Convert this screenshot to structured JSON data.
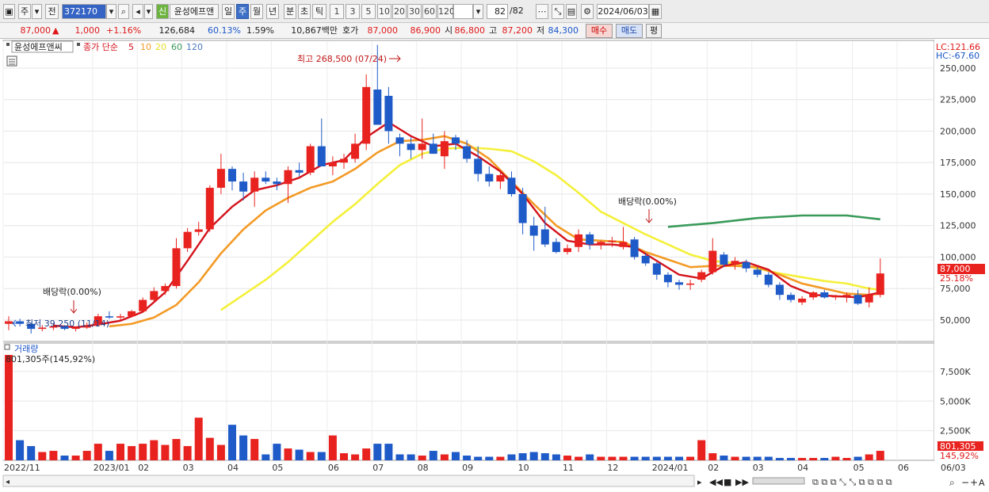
{
  "toolbar": {
    "period_type": "주",
    "prev_label": "전",
    "code": "372170",
    "name_badge": "신",
    "name": "윤성에프앤",
    "periods": [
      "일",
      "주",
      "월",
      "년",
      "분",
      "초",
      "틱"
    ],
    "active_period": "주",
    "intervals": [
      "1",
      "3",
      "5",
      "10",
      "20",
      "30",
      "60",
      "120"
    ],
    "count": "82",
    "count_total": "/82",
    "date": "2024/06/03"
  },
  "quote": {
    "price": "87,000",
    "change": "1,000",
    "change_pct": "+1.16%",
    "volume": "126,684",
    "vol_ratio": "60.13%",
    "turnover": "1.59%",
    "amount": "10,867백만",
    "ask_label": "호가",
    "ask1": "87,000",
    "ask2": "86,900",
    "open_label": "시",
    "open": "86,800",
    "high_label": "고",
    "high": "87,200",
    "low_label": "저",
    "low": "84,300",
    "buy_label": "매수",
    "sell_label": "매도",
    "avg_label": "평"
  },
  "legend": {
    "name": "윤성에프앤씨",
    "indicator": "종가 단순",
    "ma_labels": [
      "5",
      "10",
      "20",
      "60",
      "120"
    ]
  },
  "annotations": {
    "high": "최고 268,500 (07/24)",
    "low": "최저 39,250 (11/14)",
    "div1": "배당락(0.00%)",
    "div2": "배당락(0.00%)",
    "lc": "LC:121.66",
    "hc": "HC:-67.60",
    "last_price_tag": "87,000",
    "last_pct_tag": "25.18%"
  },
  "volume_panel": {
    "title": "거래량",
    "top_label": "801,305주(145,92%)",
    "last_tag": "801,305",
    "last_pct": "145,92%"
  },
  "price_axis_labels": [
    "250,000",
    "225,000",
    "200,000",
    "175,000",
    "150,000",
    "125,000",
    "100,000",
    "75,000",
    "50,000"
  ],
  "volume_axis_labels": [
    "7,500K",
    "5,000K",
    "2,500K"
  ],
  "x_axis_labels": [
    "2022/11",
    "2023/01",
    "02",
    "03",
    "04",
    "05",
    "06",
    "07",
    "08",
    "09",
    "10",
    "11",
    "12",
    "2024/01",
    "02",
    "03",
    "04",
    "05",
    "06",
    "06/03"
  ],
  "colors": {
    "up": "#e8231f",
    "down": "#1f5bc8",
    "ma5": "#d4121b",
    "ma10": "#f39a25",
    "ma20": "#f4f03a",
    "ma60": "#3a9a5a"
  },
  "chart_data": {
    "type": "candlestick",
    "x_unit": "week",
    "ohlc": [
      [
        47000,
        53000,
        42000,
        49000
      ],
      [
        49000,
        51000,
        45000,
        47000
      ],
      [
        47000,
        48000,
        39250,
        43000
      ],
      [
        43000,
        46000,
        41000,
        44000
      ],
      [
        44000,
        47000,
        42000,
        45000
      ],
      [
        45000,
        46000,
        42000,
        43000
      ],
      [
        43000,
        45000,
        41000,
        44000
      ],
      [
        44000,
        48000,
        43000,
        46000
      ],
      [
        46000,
        55000,
        45000,
        53000
      ],
      [
        53000,
        57000,
        51000,
        52000
      ],
      [
        52000,
        55000,
        50000,
        53000
      ],
      [
        53000,
        58000,
        52000,
        57000
      ],
      [
        57000,
        68000,
        56000,
        66000
      ],
      [
        66000,
        76000,
        64000,
        73000
      ],
      [
        73000,
        79000,
        70000,
        77000
      ],
      [
        77000,
        115000,
        75000,
        107000
      ],
      [
        107000,
        123000,
        104000,
        120000
      ],
      [
        120000,
        128000,
        117000,
        122000
      ],
      [
        122000,
        157000,
        120000,
        155000
      ],
      [
        155000,
        182000,
        150000,
        170000
      ],
      [
        170000,
        172000,
        153000,
        160000
      ],
      [
        160000,
        167000,
        145000,
        152000
      ],
      [
        152000,
        168000,
        140000,
        163000
      ],
      [
        163000,
        168000,
        158000,
        160000
      ],
      [
        160000,
        163000,
        153000,
        158000
      ],
      [
        158000,
        172000,
        143000,
        169000
      ],
      [
        169000,
        175000,
        164000,
        167000
      ],
      [
        167000,
        190000,
        165000,
        188000
      ],
      [
        188000,
        210000,
        175000,
        172000
      ],
      [
        172000,
        180000,
        165000,
        175000
      ],
      [
        175000,
        182000,
        170000,
        178000
      ],
      [
        178000,
        198000,
        175000,
        190000
      ],
      [
        190000,
        245000,
        185000,
        235000
      ],
      [
        233000,
        268500,
        210000,
        205000
      ],
      [
        228000,
        235000,
        190000,
        200000
      ],
      [
        195000,
        198000,
        180000,
        190000
      ],
      [
        190000,
        195000,
        178000,
        185000
      ],
      [
        185000,
        210000,
        178000,
        190000
      ],
      [
        190000,
        198000,
        182000,
        182000
      ],
      [
        180000,
        200000,
        170000,
        192000
      ],
      [
        195000,
        197000,
        185000,
        190000
      ],
      [
        188000,
        193000,
        175000,
        178000
      ],
      [
        178000,
        188000,
        160000,
        166000
      ],
      [
        166000,
        172000,
        156000,
        160000
      ],
      [
        160000,
        168000,
        154000,
        165000
      ],
      [
        163000,
        168000,
        148000,
        150000
      ],
      [
        150000,
        155000,
        118000,
        127000
      ],
      [
        125000,
        132000,
        105000,
        117000
      ],
      [
        122000,
        140000,
        108000,
        110000
      ],
      [
        112000,
        115000,
        103000,
        104000
      ],
      [
        104000,
        110000,
        102000,
        107000
      ],
      [
        108000,
        122000,
        104000,
        118000
      ],
      [
        118000,
        120000,
        106000,
        110000
      ],
      [
        110000,
        113000,
        106000,
        112000
      ],
      [
        112000,
        116000,
        108000,
        113000
      ],
      [
        108000,
        124000,
        106000,
        112000
      ],
      [
        114000,
        116000,
        98000,
        100000
      ],
      [
        101000,
        103000,
        93000,
        95000
      ],
      [
        95000,
        96000,
        82000,
        86000
      ],
      [
        86000,
        88000,
        76000,
        80000
      ],
      [
        80000,
        82000,
        74000,
        78000
      ],
      [
        78000,
        82000,
        74000,
        79000
      ],
      [
        82000,
        90000,
        80000,
        88000
      ],
      [
        88000,
        115000,
        86000,
        105000
      ],
      [
        102000,
        104000,
        92000,
        94000
      ],
      [
        94000,
        100000,
        90000,
        97000
      ],
      [
        96000,
        98000,
        88000,
        91000
      ],
      [
        90000,
        92000,
        84000,
        86000
      ],
      [
        86000,
        88000,
        76000,
        78000
      ],
      [
        78000,
        80000,
        66000,
        70000
      ],
      [
        70000,
        72000,
        64000,
        66000
      ],
      [
        64000,
        69000,
        62000,
        67000
      ],
      [
        68000,
        73000,
        66000,
        72000
      ],
      [
        72000,
        74000,
        67000,
        68000
      ],
      [
        68000,
        70000,
        66000,
        69000
      ],
      [
        69000,
        72000,
        64000,
        70000
      ],
      [
        70000,
        74000,
        62000,
        63000
      ],
      [
        64000,
        76000,
        60000,
        70000
      ],
      [
        70000,
        99000,
        68000,
        87000
      ]
    ],
    "ma5": [
      [
        4,
        45600
      ],
      [
        6,
        44200
      ],
      [
        8,
        46500
      ],
      [
        10,
        49500
      ],
      [
        12,
        56500
      ],
      [
        14,
        72000
      ],
      [
        16,
        97000
      ],
      [
        18,
        123000
      ],
      [
        20,
        140000
      ],
      [
        22,
        153000
      ],
      [
        24,
        157000
      ],
      [
        26,
        163000
      ],
      [
        28,
        173000
      ],
      [
        30,
        177000
      ],
      [
        32,
        195000
      ],
      [
        34,
        207000
      ],
      [
        36,
        196000
      ],
      [
        38,
        188000
      ],
      [
        40,
        190000
      ],
      [
        42,
        180000
      ],
      [
        44,
        168000
      ],
      [
        46,
        150000
      ],
      [
        48,
        127000
      ],
      [
        50,
        113000
      ],
      [
        52,
        110000
      ],
      [
        54,
        110000
      ],
      [
        56,
        108000
      ],
      [
        58,
        97000
      ],
      [
        60,
        86000
      ],
      [
        62,
        83000
      ],
      [
        64,
        93000
      ],
      [
        66,
        96000
      ],
      [
        68,
        90000
      ],
      [
        70,
        77000
      ],
      [
        72,
        70000
      ],
      [
        74,
        69000
      ],
      [
        76,
        68000
      ],
      [
        78,
        72000
      ]
    ],
    "ma10": [
      [
        9,
        45000
      ],
      [
        11,
        47000
      ],
      [
        13,
        52000
      ],
      [
        15,
        62000
      ],
      [
        17,
        80000
      ],
      [
        19,
        103000
      ],
      [
        21,
        122000
      ],
      [
        23,
        137000
      ],
      [
        25,
        147000
      ],
      [
        27,
        155000
      ],
      [
        29,
        160000
      ],
      [
        31,
        170000
      ],
      [
        33,
        183000
      ],
      [
        35,
        192000
      ],
      [
        37,
        193000
      ],
      [
        39,
        196000
      ],
      [
        41,
        190000
      ],
      [
        43,
        178000
      ],
      [
        45,
        160000
      ],
      [
        47,
        142000
      ],
      [
        49,
        125000
      ],
      [
        51,
        114000
      ],
      [
        53,
        113000
      ],
      [
        55,
        112000
      ],
      [
        57,
        104000
      ],
      [
        59,
        98000
      ],
      [
        61,
        92000
      ],
      [
        63,
        93000
      ],
      [
        65,
        93000
      ],
      [
        67,
        92000
      ],
      [
        69,
        86000
      ],
      [
        71,
        79000
      ],
      [
        73,
        75000
      ],
      [
        75,
        71000
      ],
      [
        77,
        70000
      ],
      [
        78,
        71000
      ]
    ],
    "ma20": [
      [
        19,
        58000
      ],
      [
        21,
        70000
      ],
      [
        23,
        82000
      ],
      [
        25,
        96000
      ],
      [
        27,
        112000
      ],
      [
        29,
        128000
      ],
      [
        31,
        142000
      ],
      [
        33,
        158000
      ],
      [
        35,
        173000
      ],
      [
        37,
        182000
      ],
      [
        39,
        186000
      ],
      [
        41,
        187000
      ],
      [
        43,
        186000
      ],
      [
        45,
        184000
      ],
      [
        47,
        176000
      ],
      [
        49,
        165000
      ],
      [
        51,
        151000
      ],
      [
        53,
        136000
      ],
      [
        55,
        127000
      ],
      [
        57,
        118000
      ],
      [
        59,
        110000
      ],
      [
        61,
        102000
      ],
      [
        63,
        97000
      ],
      [
        65,
        95000
      ],
      [
        67,
        91000
      ],
      [
        69,
        87000
      ],
      [
        71,
        84000
      ],
      [
        73,
        81000
      ],
      [
        75,
        79000
      ],
      [
        77,
        75000
      ],
      [
        78,
        74000
      ]
    ],
    "ma60": [
      [
        59,
        124000
      ],
      [
        63,
        127000
      ],
      [
        67,
        131000
      ],
      [
        71,
        133000
      ],
      [
        75,
        133000
      ],
      [
        78,
        130000
      ]
    ],
    "volume": [
      8900,
      1700,
      1200,
      700,
      800,
      400,
      400,
      800,
      1400,
      800,
      1400,
      1200,
      1400,
      1700,
      1300,
      1800,
      1200,
      3600,
      1900,
      1300,
      3000,
      2100,
      1800,
      500,
      1400,
      1000,
      900,
      700,
      700,
      2100,
      600,
      500,
      1000,
      1400,
      1400,
      500,
      500,
      400,
      800,
      500,
      700,
      400,
      300,
      300,
      300,
      500,
      600,
      700,
      600,
      500,
      400,
      300,
      500,
      300,
      300,
      300,
      300,
      300,
      300,
      300,
      300,
      300,
      1700,
      600,
      400,
      300,
      300,
      300,
      300,
      200,
      200,
      200,
      200,
      200,
      300,
      200,
      300,
      500,
      801
    ],
    "volume_unit": "K",
    "ylim_price": [
      33000,
      272000
    ],
    "ylim_volume": [
      0,
      9500
    ]
  }
}
